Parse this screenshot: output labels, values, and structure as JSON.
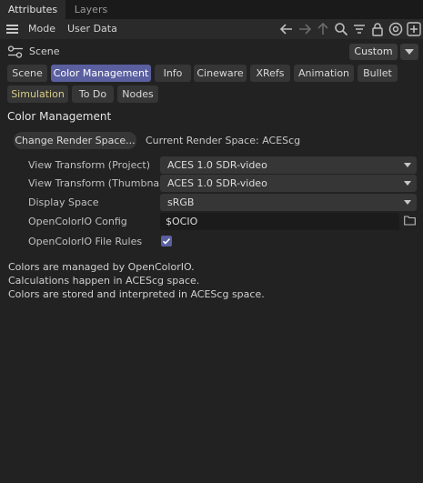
{
  "tabs": {
    "attributes": "Attributes",
    "layers": "Layers"
  },
  "menu": {
    "mode": "Mode",
    "user_data": "User Data"
  },
  "toolbar_icons": [
    "arrow-left-icon",
    "arrow-right-icon",
    "arrow-up-icon",
    "search-icon",
    "filter-icon",
    "lock-icon",
    "target-icon",
    "add-icon"
  ],
  "scene": {
    "label": "Scene",
    "dropdown": "Custom"
  },
  "tab_buttons": [
    "Scene",
    "Color Management",
    "Info",
    "Cineware",
    "XRefs",
    "Animation",
    "Bullet",
    "Simulation",
    "To Do",
    "Nodes"
  ],
  "active_tab": "Color Management",
  "section": {
    "title": "Color Management",
    "change_button": "Change Render Space...",
    "current_render_space": "Current Render Space: ACEScg"
  },
  "fields": {
    "view_transform_project": {
      "label": "View Transform (Project)",
      "value": "ACES 1.0 SDR-video"
    },
    "view_transform_thumbnails": {
      "label": "View Transform (Thumbnails)",
      "value": "ACES 1.0 SDR-video"
    },
    "display_space": {
      "label": "Display Space",
      "value": "sRGB"
    },
    "ocio_config": {
      "label": "OpenColorIO Config",
      "value": "$OCIO"
    },
    "ocio_file_rules": {
      "label": "OpenColorIO File Rules",
      "checked": true
    }
  },
  "info_lines": [
    "Colors are managed by OpenColorIO.",
    "Calculations happen in ACEScg space.",
    "Colors are stored and interpreted in ACEScg space."
  ],
  "colors": {
    "accent": "#5a5fa0",
    "background": "#222222",
    "simulation_text": "#d8cc88"
  }
}
